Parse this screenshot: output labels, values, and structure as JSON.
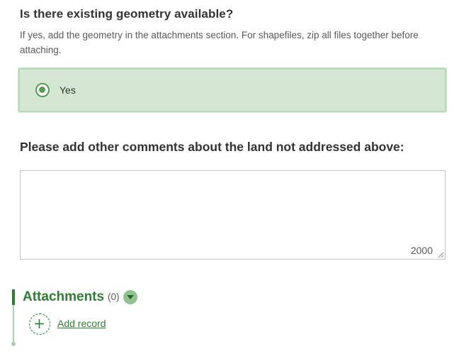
{
  "question_geometry": {
    "title": "Is there existing geometry available?",
    "hint": "If yes, add the geometry in the attachments section. For shapefiles, zip all files together before attaching.",
    "options": [
      {
        "label": "Yes",
        "selected": true
      }
    ]
  },
  "question_comments": {
    "title": "Please add other comments about the land not addressed above:",
    "value": "",
    "char_limit": "2000"
  },
  "attachments": {
    "title": "Attachments",
    "count": "(0)",
    "add_label": "Add record"
  },
  "colors": {
    "accent": "#2e7d32",
    "selected_bg": "#d3e7d3",
    "radio": "#5a9a5a"
  },
  "icons": {
    "radio": "radio-selected-icon",
    "collapse": "chevron-down-icon",
    "add": "plus-circle-icon"
  }
}
